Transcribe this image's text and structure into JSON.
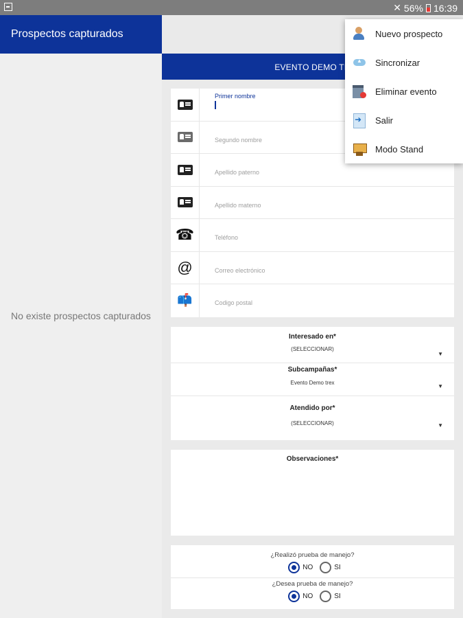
{
  "status_bar": {
    "battery_percent": "56%",
    "time": "16:39"
  },
  "left_panel": {
    "title": "Prospectos capturados",
    "empty_message": "No existe prospectos capturados"
  },
  "event_bar": {
    "title": "EVENTO DEMO TR"
  },
  "contact_fields": [
    {
      "placeholder": "Primer nombre",
      "icon": "id-card-icon"
    },
    {
      "placeholder": "Segundo nombre",
      "icon": "id-card-icon"
    },
    {
      "placeholder": "Apellido paterno",
      "icon": "id-card-icon"
    },
    {
      "placeholder": "Apellido materno",
      "icon": "id-card-icon"
    },
    {
      "placeholder": "Teléfono",
      "icon": "telephone-icon"
    },
    {
      "placeholder": "Correo electrónico",
      "icon": "at-sign-icon"
    },
    {
      "placeholder": "Codigo postal",
      "icon": "mailbox-icon"
    }
  ],
  "selects": [
    {
      "label": "Interesado en*",
      "value": "(SELECCIONAR)"
    },
    {
      "label": "Subcampañas*",
      "value": "Evento Demo trex"
    },
    {
      "label": "Atendido por*",
      "value": "(SELECCIONAR)"
    }
  ],
  "observations": {
    "label": "Observaciones*"
  },
  "questions": [
    {
      "text": "¿Realizó prueba de manejo?",
      "option_no": "NO",
      "option_yes": "SI",
      "selected": "NO"
    },
    {
      "text": "¿Desea prueba de manejo?",
      "option_no": "NO",
      "option_yes": "SI",
      "selected": "NO"
    }
  ],
  "menu": {
    "items": [
      {
        "label": "Nuevo prospecto",
        "icon": "new-user-icon"
      },
      {
        "label": "Sincronizar",
        "icon": "cloud-upload-icon"
      },
      {
        "label": "Eliminar evento",
        "icon": "delete-calendar-icon"
      },
      {
        "label": "Salir",
        "icon": "exit-icon"
      },
      {
        "label": "Modo Stand",
        "icon": "stand-icon"
      }
    ]
  },
  "colors": {
    "primary": "#0d3399",
    "background": "#eaeaea"
  }
}
